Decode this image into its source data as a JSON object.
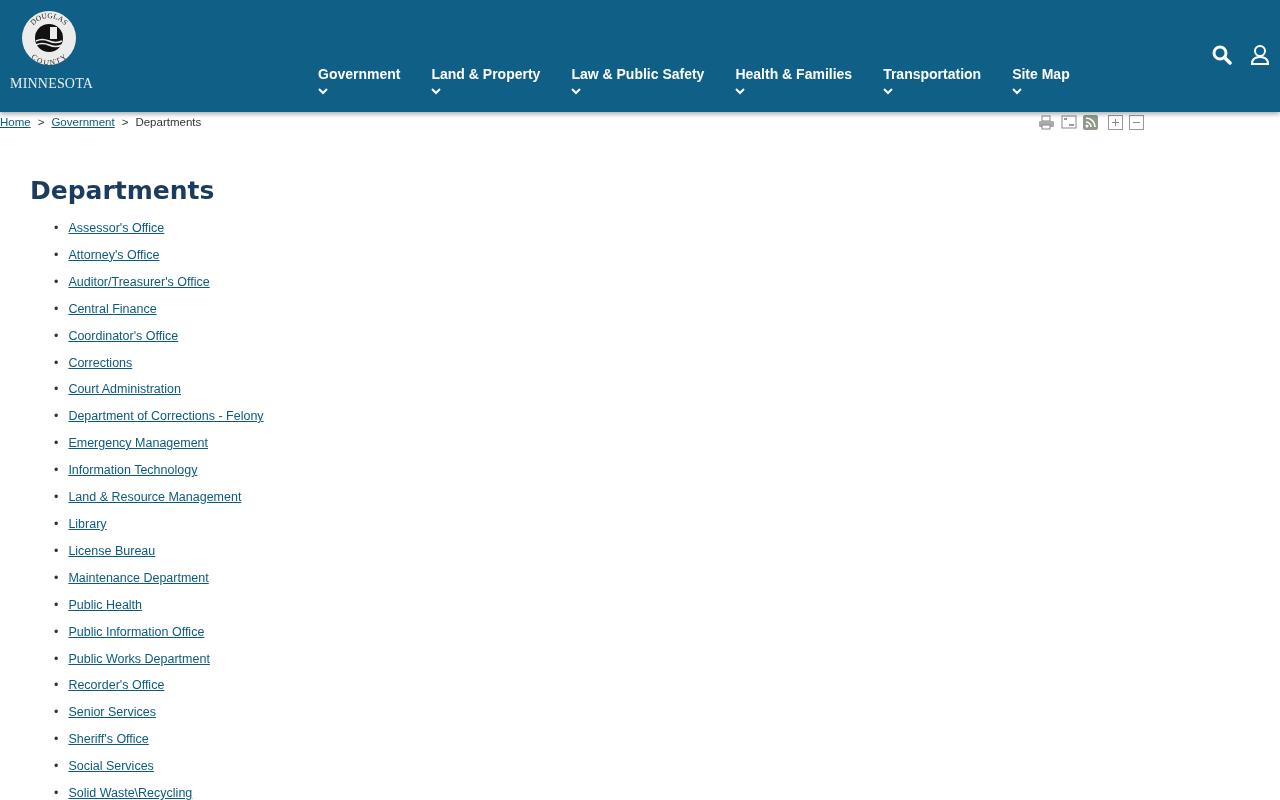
{
  "logo": {
    "seal_top": "DOUGLAS",
    "seal_bottom": "COUNTY",
    "state": "MINNESOTA"
  },
  "nav": [
    {
      "label": "Government"
    },
    {
      "label": "Land & Property"
    },
    {
      "label": "Law & Public Safety"
    },
    {
      "label": "Health & Families"
    },
    {
      "label": "Transportation"
    },
    {
      "label": "Site Map"
    }
  ],
  "breadcrumb": [
    {
      "label": "Home",
      "kind": "link"
    },
    {
      "label": ">",
      "kind": "sep"
    },
    {
      "label": "Government",
      "kind": "link"
    },
    {
      "label": ">",
      "kind": "sep"
    },
    {
      "label": "Departments",
      "kind": "current"
    }
  ],
  "page_title": "Departments",
  "departments": [
    {
      "bullet": "•",
      "label": "Assessor's Office"
    },
    {
      "bullet": "•",
      "label": "Attorney's Office"
    },
    {
      "bullet": "•",
      "label": "Auditor/Treasurer's Office"
    },
    {
      "bullet": "•",
      "label": "Central Finance"
    },
    {
      "bullet": "•",
      "label": "Coordinator's Office"
    },
    {
      "bullet": "•",
      "label": "Corrections"
    },
    {
      "bullet": "•",
      "label": "Court Administration"
    },
    {
      "bullet": "•",
      "label": "Department of Corrections - Felony"
    },
    {
      "bullet": "•",
      "label": "Emergency Management"
    },
    {
      "bullet": "•",
      "label": "Information Technology"
    },
    {
      "bullet": "•",
      "label": "Land & Resource Management"
    },
    {
      "bullet": "•",
      "label": "Library"
    },
    {
      "bullet": "•",
      "label": "License Bureau"
    },
    {
      "bullet": "•",
      "label": "Maintenance Department"
    },
    {
      "bullet": "•",
      "label": "Public Health"
    },
    {
      "bullet": "•",
      "label": "Public Information Office"
    },
    {
      "bullet": "•",
      "label": "Public Works Department"
    },
    {
      "bullet": "•",
      "label": "Recorder's Office"
    },
    {
      "bullet": "•",
      "label": "Senior Services"
    },
    {
      "bullet": "•",
      "label": "Sheriff's Office"
    },
    {
      "bullet": "•",
      "label": "Social Services"
    },
    {
      "bullet": "•",
      "label": "Solid Waste\\Recycling"
    }
  ]
}
